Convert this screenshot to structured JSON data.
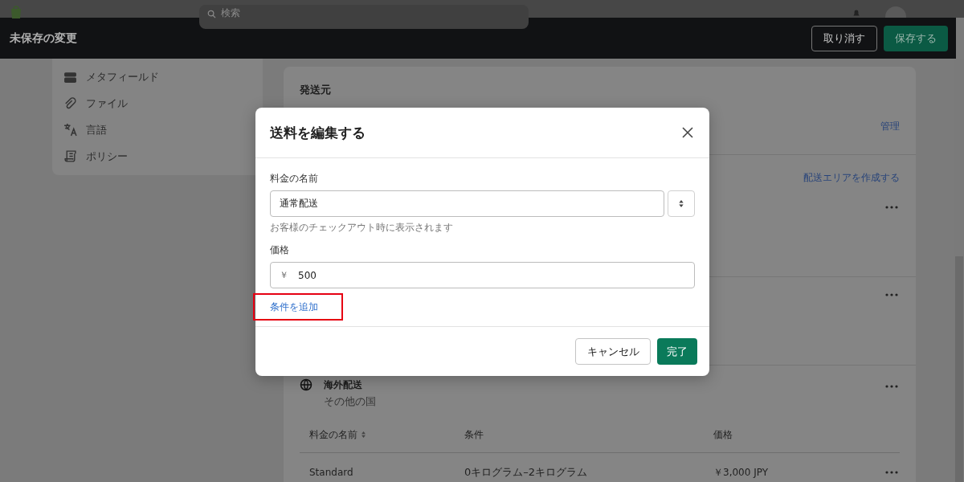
{
  "top_bar": {
    "search": {
      "placeholder": "検索"
    }
  },
  "save_bar": {
    "title": "未保存の変更",
    "buttons": [
      {
        "label": "取り消す",
        "kind": "secondary"
      },
      {
        "label": "保存する",
        "kind": "primary"
      }
    ]
  },
  "sidebar": {
    "items": [
      {
        "label": "メタフィールド"
      },
      {
        "label": "ファイル"
      },
      {
        "label": "言語"
      },
      {
        "label": "ポリシー"
      }
    ]
  },
  "shipping_card": {
    "origin_title": "発送元",
    "manage_link": "管理",
    "create_zone_link": "配送エリアを作成する",
    "zone": {
      "name": "海外配送",
      "subtitle": "その他の国"
    },
    "table": {
      "columns": [
        {
          "label": "料金の名前",
          "sortable": true
        },
        {
          "label": "条件",
          "sortable": false
        },
        {
          "label": "価格",
          "sortable": false
        }
      ],
      "rows": [
        {
          "cells": [
            "Standard",
            "0キログラム–2キログラム",
            "￥3,000 JPY"
          ]
        }
      ]
    }
  },
  "modal": {
    "title": "送料を編集する",
    "name_field": {
      "label": "料金の名前",
      "value": "通常配送",
      "help": "お客様のチェックアウト時に表示されます"
    },
    "price_field": {
      "label": "価格",
      "prefix": "￥",
      "value": "500"
    },
    "add_condition_link": {
      "label": "条件を追加",
      "highlighted": true
    },
    "buttons": [
      {
        "label": "キャンセル",
        "kind": "secondary"
      },
      {
        "label": "完了",
        "kind": "primary"
      }
    ]
  }
}
